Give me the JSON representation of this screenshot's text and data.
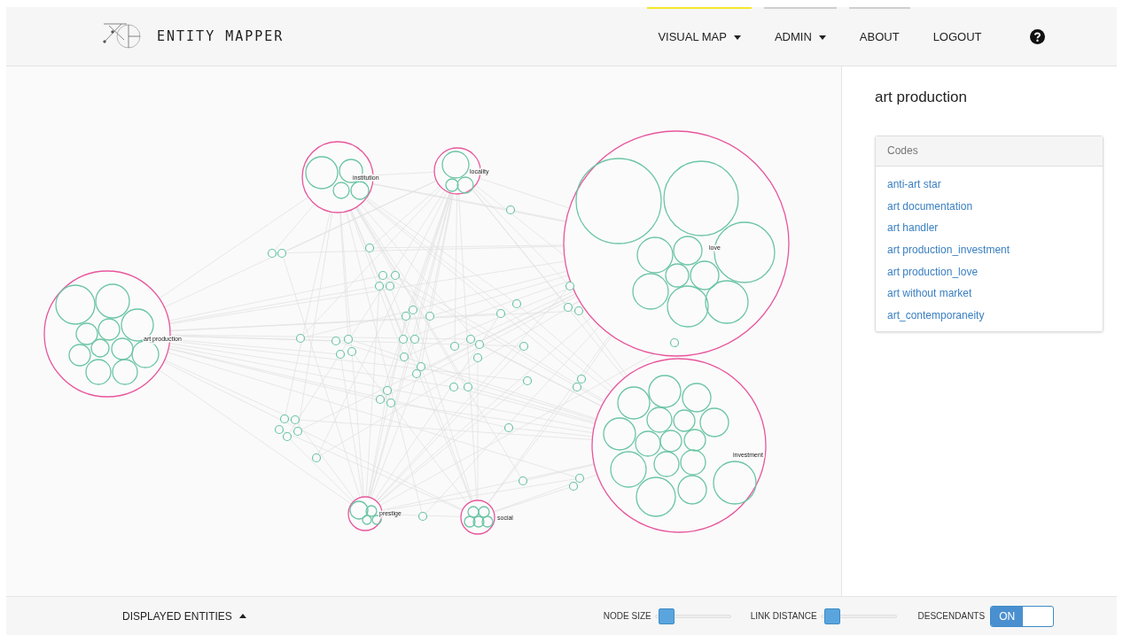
{
  "header": {
    "title": "ENTITY MAPPER",
    "nav": [
      {
        "label": "VISUAL MAP",
        "dropdown": true,
        "selected": true,
        "bar": true
      },
      {
        "label": "ADMIN",
        "dropdown": true,
        "selected": false,
        "bar": true
      },
      {
        "label": "ABOUT",
        "dropdown": false,
        "selected": false,
        "bar": true
      },
      {
        "label": "LOGOUT",
        "dropdown": false,
        "selected": false,
        "bar": false
      }
    ]
  },
  "map": {
    "clusters": [
      {
        "label": "institution"
      },
      {
        "label": "locality"
      },
      {
        "label": "love"
      },
      {
        "label": "art production"
      },
      {
        "label": "investment"
      },
      {
        "label": "prestige"
      },
      {
        "label": "social"
      }
    ]
  },
  "sidebar": {
    "title": "art production",
    "panel": {
      "title": "Codes",
      "items": [
        "anti-art star",
        "art documentation",
        "art handler",
        "art production_investment",
        "art production_love",
        "art without market",
        "art_contemporaneity"
      ]
    }
  },
  "bottom_bar": {
    "entities": {
      "label": "DISPLAYED ENTITIES"
    },
    "sliders": [
      {
        "label": "NODE SIZE",
        "level": 0.05
      },
      {
        "label": "LINK DISTANCE",
        "level": 0.05
      }
    ],
    "toggle": {
      "label": "DESCENDANTS",
      "on_label": "ON",
      "on": true
    }
  }
}
